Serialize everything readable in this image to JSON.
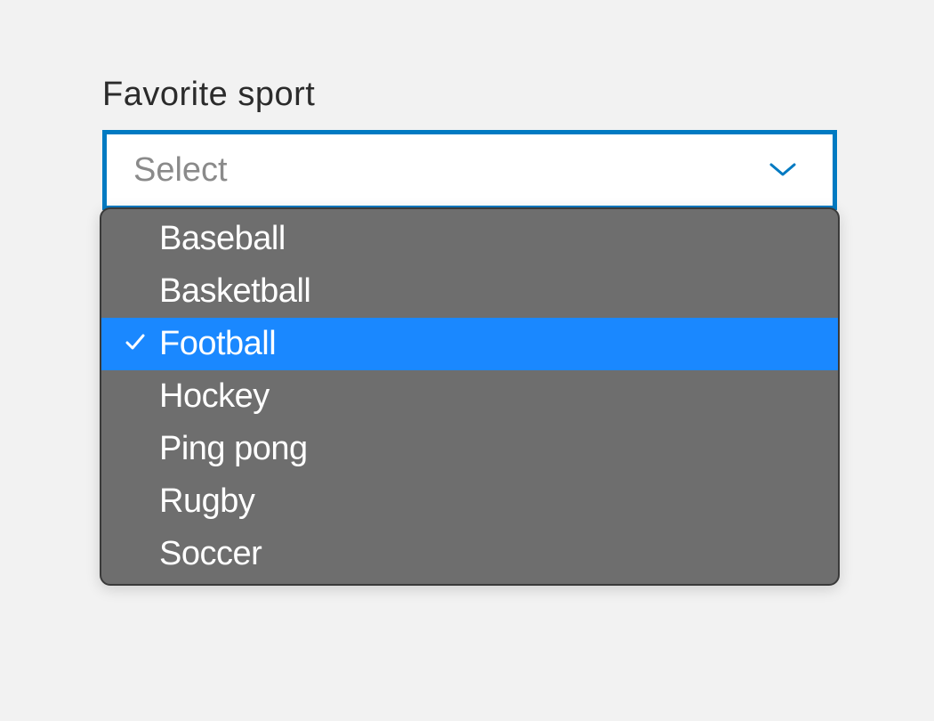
{
  "field": {
    "label": "Favorite sport",
    "placeholder": "Select"
  },
  "options": [
    {
      "label": "Baseball",
      "selected": false
    },
    {
      "label": "Basketball",
      "selected": false
    },
    {
      "label": "Football",
      "selected": true
    },
    {
      "label": "Hockey",
      "selected": false
    },
    {
      "label": "Ping pong",
      "selected": false
    },
    {
      "label": "Rugby",
      "selected": false
    },
    {
      "label": "Soccer",
      "selected": false
    }
  ],
  "colors": {
    "accent": "#007ac2",
    "highlight": "#1a88ff",
    "panel": "#6e6e6e",
    "background": "#f2f2f2"
  }
}
